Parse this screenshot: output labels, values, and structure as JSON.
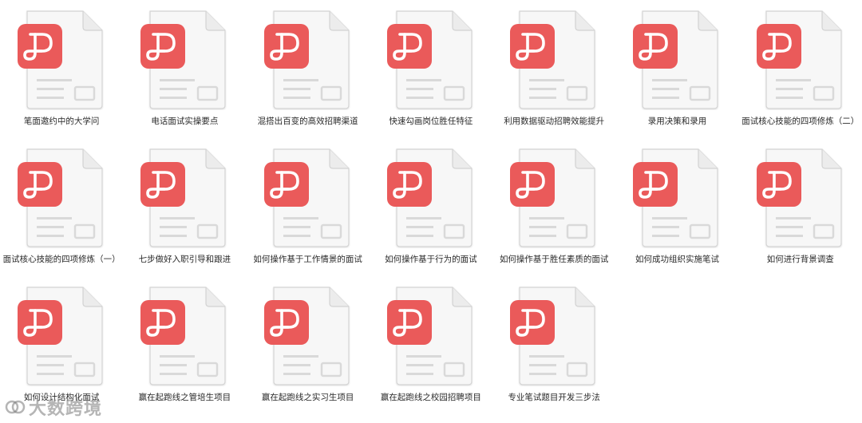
{
  "files": [
    {
      "name": "笔面邀约中的大学问",
      "icon": "pdf-file-icon"
    },
    {
      "name": "电话面试实操要点",
      "icon": "pdf-file-icon"
    },
    {
      "name": "混搭出百变的高效招聘渠道",
      "icon": "pdf-file-icon"
    },
    {
      "name": "快速勾画岗位胜任特征",
      "icon": "pdf-file-icon"
    },
    {
      "name": "利用数据驱动招聘效能提升",
      "icon": "pdf-file-icon"
    },
    {
      "name": "录用决策和录用",
      "icon": "pdf-file-icon"
    },
    {
      "name": "面试核心技能的四项修炼（二）",
      "icon": "pdf-file-icon"
    },
    {
      "name": "面试核心技能的四项修炼（一）",
      "icon": "pdf-file-icon"
    },
    {
      "name": "七步做好入职引导和跟进",
      "icon": "pdf-file-icon"
    },
    {
      "name": "如何操作基于工作情景的面试",
      "icon": "pdf-file-icon"
    },
    {
      "name": "如何操作基于行为的面试",
      "icon": "pdf-file-icon"
    },
    {
      "name": "如何操作基于胜任素质的面试",
      "icon": "pdf-file-icon"
    },
    {
      "name": "如何成功组织实施笔试",
      "icon": "pdf-file-icon"
    },
    {
      "name": "如何进行背景调查",
      "icon": "pdf-file-icon"
    },
    {
      "name": "如何设计结构化面试",
      "icon": "pdf-file-icon"
    },
    {
      "name": "赢在起跑线之管培生项目",
      "icon": "pdf-file-icon"
    },
    {
      "name": "赢在起跑线之实习生项目",
      "icon": "pdf-file-icon"
    },
    {
      "name": "赢在起跑线之校园招聘项目",
      "icon": "pdf-file-icon"
    },
    {
      "name": "专业笔试题目开发三步法",
      "icon": "pdf-file-icon"
    }
  ],
  "watermark": {
    "text": "大数跨境"
  },
  "colors": {
    "pdf_badge": "#ea5a5a",
    "page_fill": "#f7f7f7",
    "page_stroke": "#d3d3d3",
    "page_lines": "#d9d9d9"
  }
}
